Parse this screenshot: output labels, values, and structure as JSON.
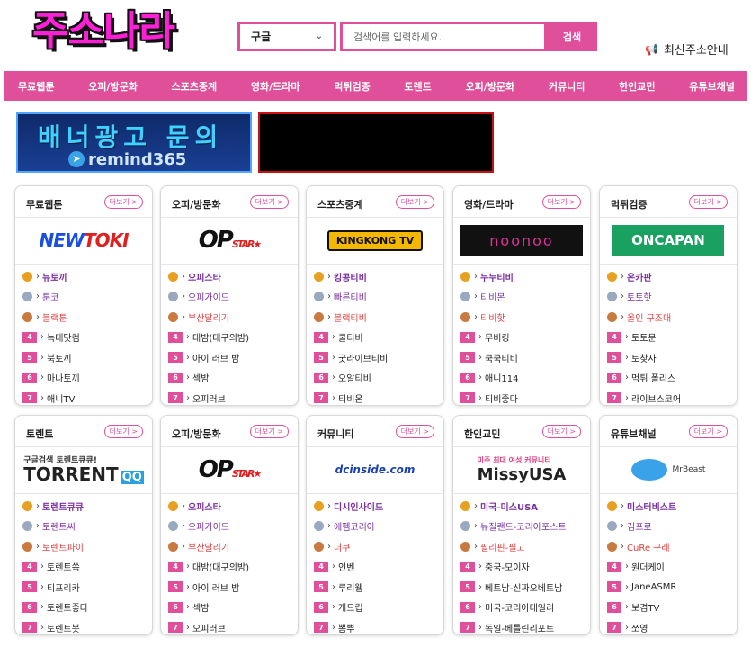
{
  "site_title": "주소나라",
  "search": {
    "engine": "구글",
    "placeholder": "검색어를 입력하세요.",
    "button": "검색"
  },
  "notice": "최신주소안내",
  "nav": [
    "무료웹툰",
    "오피/방문화",
    "스포츠중계",
    "영화/드라마",
    "먹튀검증",
    "토렌트",
    "오피/방문화",
    "커뮤니티",
    "한인교민",
    "유튜브채널"
  ],
  "banners": {
    "ad_title": "배너광고 문의",
    "ad_contact": "remind365"
  },
  "more_label": "더보기 >",
  "cards": [
    {
      "title": "무료웹툰",
      "logo": "NEWTOKI",
      "items": [
        "뉴토끼",
        "툰코",
        "블랙툰",
        "늑대닷컴",
        "북토끼",
        "마나토끼",
        "애니TV"
      ]
    },
    {
      "title": "오피/방문화",
      "logo": "OPSTAR",
      "items": [
        "오피스타",
        "오피가이드",
        "부산달리기",
        "대밤(대구의밤)",
        "아이 러브 밤",
        "섹밤",
        "오피러브"
      ]
    },
    {
      "title": "스포츠중계",
      "logo": "KINGKONG TV",
      "items": [
        "킹콩티비",
        "빠른티비",
        "블랙티비",
        "쿨티비",
        "굿라이브티비",
        "오알티비",
        "티비온"
      ]
    },
    {
      "title": "영화/드라마",
      "logo": "noonoo",
      "items": [
        "누누티비",
        "티비몬",
        "티비핫",
        "무비킹",
        "쿡쿡티비",
        "애니114",
        "티비좋다"
      ]
    },
    {
      "title": "먹튀검증",
      "logo": "ONCAPAN",
      "items": [
        "온카판",
        "토토핫",
        "올인 구조대",
        "토토문",
        "토찾사",
        "먹튀 폴리스",
        "라이브스코어"
      ]
    },
    {
      "title": "토렌트",
      "logo": "TORRENT",
      "items": [
        "토렌트큐큐",
        "토렌트씨",
        "토렌트파이",
        "토렌트쏙",
        "티프리카",
        "토렌트좋다",
        "토렌트봇"
      ]
    },
    {
      "title": "오피/방문화",
      "logo": "OPSTAR",
      "items": [
        "오피스타",
        "오피가이드",
        "부산달리기",
        "대밤(대구의밤)",
        "아이 러브 밤",
        "섹밤",
        "오피러브"
      ]
    },
    {
      "title": "커뮤니티",
      "logo": "dcinside.com",
      "items": [
        "디시인사이드",
        "에펨코리아",
        "더쿠",
        "인벤",
        "루리웹",
        "개드립",
        "뽐뿌"
      ]
    },
    {
      "title": "한인교민",
      "logo": "MissyUSA",
      "items": [
        "미국-미스USA",
        "뉴질랜드-코리아포스트",
        "필리핀-필고",
        "중국-모이자",
        "베트남-신짜오베트남",
        "미국-코리아데일리",
        "독일-베를린리포트"
      ]
    },
    {
      "title": "유튜브채널",
      "logo": "MrBeast",
      "items": [
        "미스터비스트",
        "김프로",
        "CuRe 구레",
        "원더케이",
        "JaneASMR",
        "보겸TV",
        "쏘영"
      ]
    }
  ],
  "logo_text": {
    "torrent_top": "구글검색 토렌트큐큐!",
    "missy_top": "미주 최대 여성 커뮤니티"
  }
}
